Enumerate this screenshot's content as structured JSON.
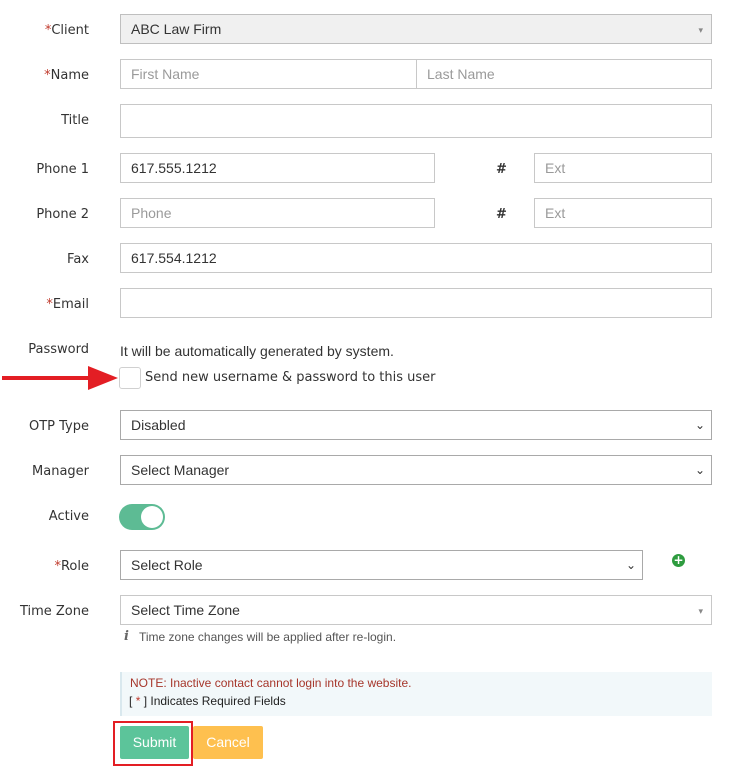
{
  "form": {
    "client": {
      "label": "Client",
      "value": "ABC Law Firm"
    },
    "name": {
      "label": "Name",
      "first_placeholder": "First Name",
      "last_placeholder": "Last Name"
    },
    "title": {
      "label": "Title",
      "value": ""
    },
    "phone1": {
      "label": "Phone 1",
      "value": "617.555.1212",
      "hash": "#",
      "ext_placeholder": "Ext"
    },
    "phone2": {
      "label": "Phone 2",
      "placeholder": "Phone",
      "hash": "#",
      "ext_placeholder": "Ext"
    },
    "fax": {
      "label": "Fax",
      "value": "617.554.1212"
    },
    "email": {
      "label": "Email",
      "value": ""
    },
    "password": {
      "label": "Password",
      "info": "It will be automatically generated by system.",
      "send_checkbox_label": "Send new username & password to this user"
    },
    "otp_type": {
      "label": "OTP Type",
      "value": "Disabled"
    },
    "manager": {
      "label": "Manager",
      "value": "Select Manager"
    },
    "active": {
      "label": "Active",
      "checked": true
    },
    "role": {
      "label": "Role",
      "value": "Select Role"
    },
    "time_zone": {
      "label": "Time Zone",
      "value": "Select Time Zone",
      "note": "Time zone changes will be applied after re-login."
    },
    "required_marker": "*"
  },
  "notes": {
    "inactive": "NOTE: Inactive contact cannot login into the website.",
    "required_prefix": "[",
    "required_star": "*",
    "required_suffix": "] Indicates Required Fields"
  },
  "buttons": {
    "submit": "Submit",
    "cancel": "Cancel"
  },
  "icons": {
    "dropdown": "▾",
    "select_chevron": "⌄",
    "add": "+",
    "info": "i"
  },
  "colors": {
    "required": "#c0392b",
    "toggle_on": "#5dbb94",
    "submit": "#5cc49a",
    "cancel": "#fec04f",
    "highlight": "#e31e24"
  }
}
